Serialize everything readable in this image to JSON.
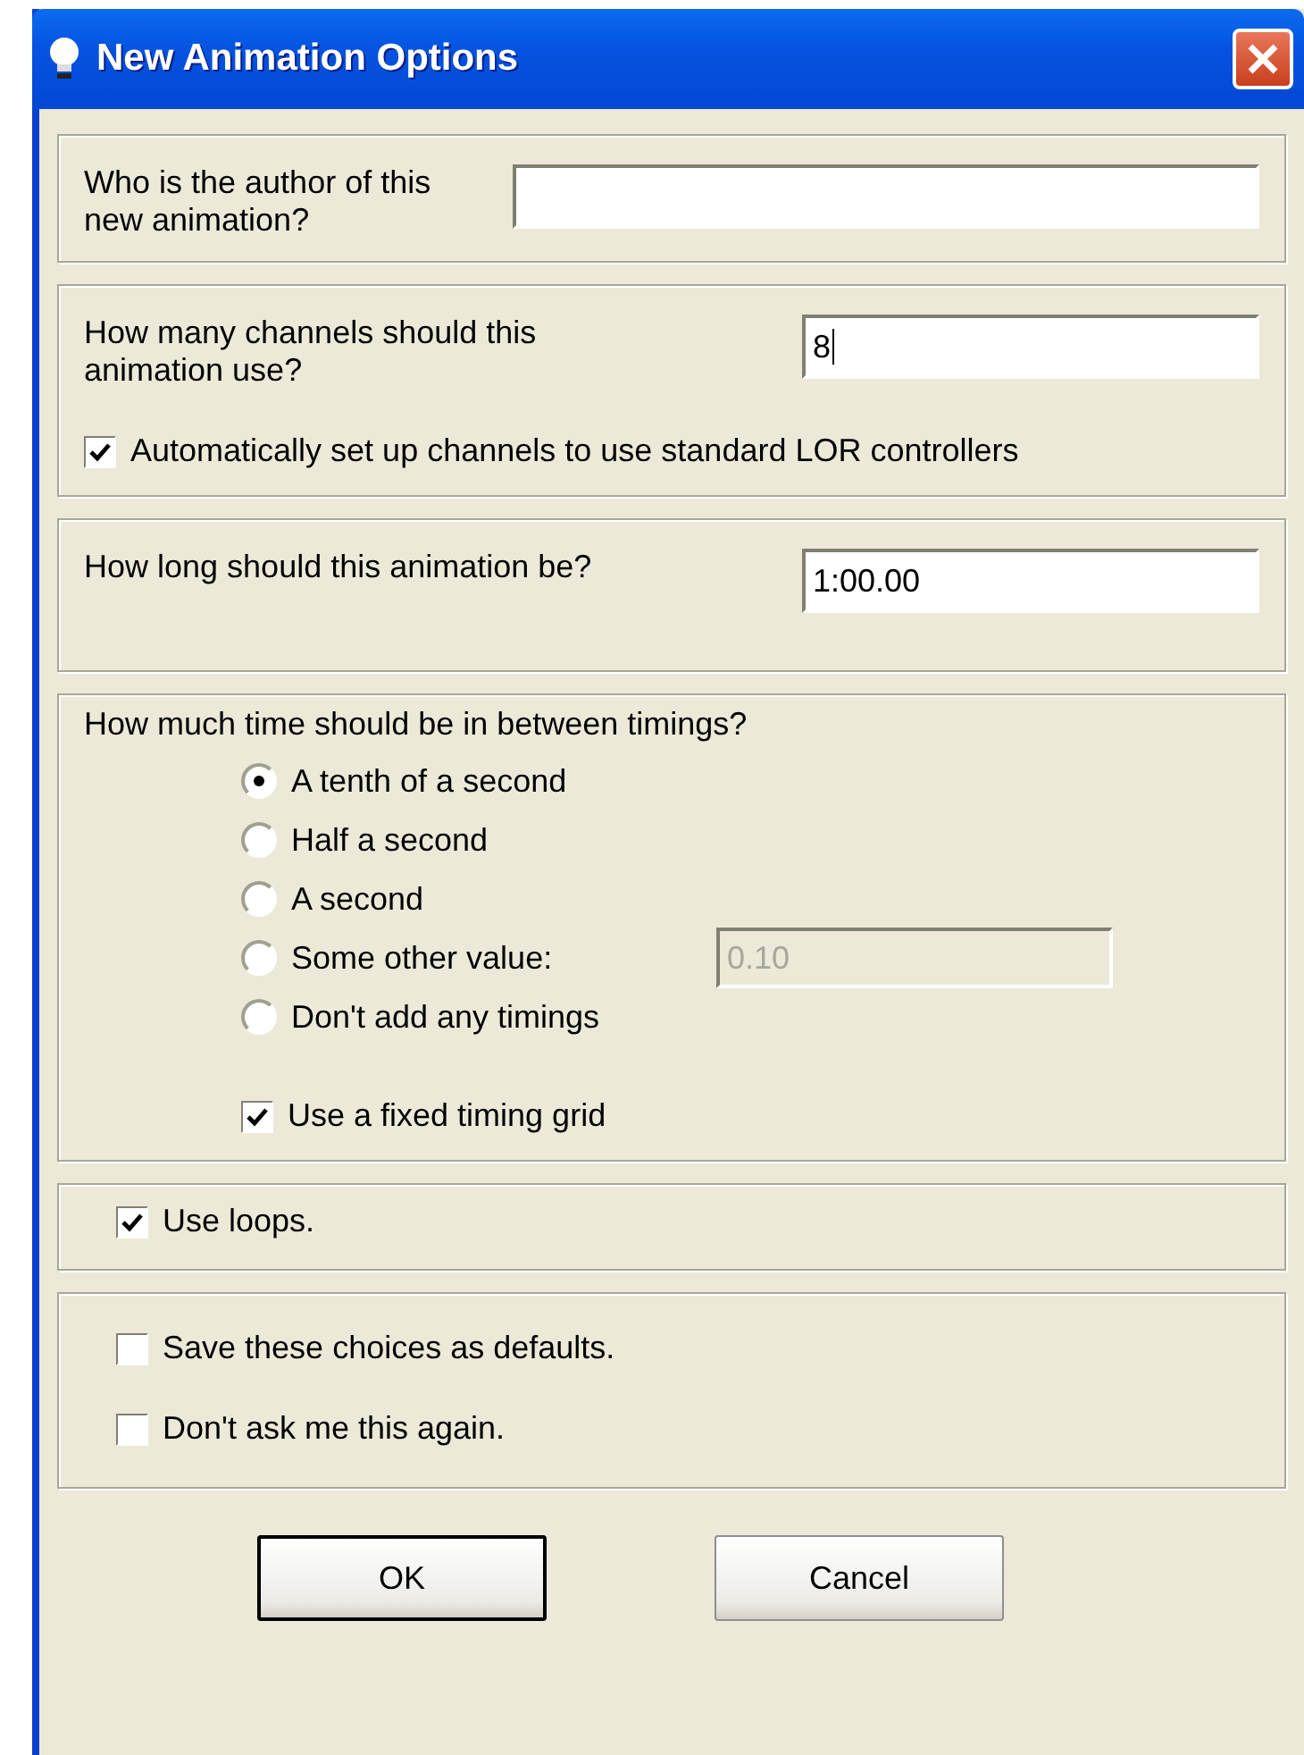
{
  "window": {
    "title": "New Animation Options"
  },
  "author": {
    "label": "Who is the author of this new animation?"
  },
  "channels": {
    "label": "How many channels should this animation use?",
    "value": "8",
    "auto_setup": {
      "label": "Automatically set up channels to use standard LOR controllers",
      "checked": true
    }
  },
  "length": {
    "label": "How long should this animation be?",
    "value": "1:00.00"
  },
  "timing": {
    "label": "How much time should be in between timings?",
    "options": [
      {
        "label": "A tenth of a second",
        "selected": true
      },
      {
        "label": "Half a second",
        "selected": false
      },
      {
        "label": "A second",
        "selected": false
      },
      {
        "label": "Some other value:",
        "selected": false,
        "field": {
          "value": "0.10",
          "disabled": true
        }
      },
      {
        "label": "Don't add any timings",
        "selected": false
      }
    ],
    "fixed_grid": {
      "label": "Use a fixed timing grid",
      "checked": true
    }
  },
  "loops": {
    "label": "Use loops.",
    "checked": true
  },
  "preferences": [
    {
      "label": "Save these choices as defaults.",
      "checked": false
    },
    {
      "label": "Don't ask me this again.",
      "checked": false
    }
  ],
  "buttons": [
    {
      "label": "OK",
      "default": true
    },
    {
      "label": "Cancel",
      "default": false
    }
  ]
}
